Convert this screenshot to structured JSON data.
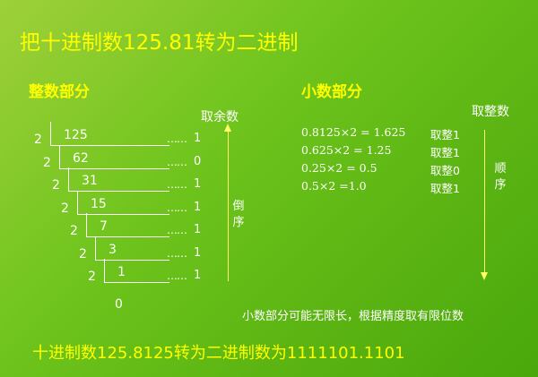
{
  "title": "把十进制数125.81转为二进制",
  "integer_part": {
    "heading": "整数部分",
    "remainder_label": "取余数",
    "reverse_label": "倒序",
    "steps": [
      {
        "divisor": "2",
        "value": "125",
        "dots": "……",
        "remainder": "1"
      },
      {
        "divisor": "2",
        "value": "62",
        "dots": "……",
        "remainder": "0"
      },
      {
        "divisor": "2",
        "value": "31",
        "dots": "……",
        "remainder": "1"
      },
      {
        "divisor": "2",
        "value": "15",
        "dots": "……",
        "remainder": "1"
      },
      {
        "divisor": "2",
        "value": "7",
        "dots": "……",
        "remainder": "1"
      },
      {
        "divisor": "2",
        "value": "3",
        "dots": "……",
        "remainder": "1"
      },
      {
        "divisor": "2",
        "value": "1",
        "dots": "……",
        "remainder": "1"
      }
    ],
    "final": "0"
  },
  "fraction_part": {
    "heading": "小数部分",
    "take_label": "取整数",
    "order_label": "顺序",
    "rows": [
      {
        "expr": "0.8125×2 = 1.625",
        "take": "取整1"
      },
      {
        "expr": "0.625×2 = 1.25",
        "take": "取整1"
      },
      {
        "expr": "0.25×2 = 0.5",
        "take": "取整0"
      },
      {
        "expr": "0.5×2 =1.0",
        "take": "取整1"
      }
    ],
    "note": "小数部分可能无限长，根据精度取有限位数"
  },
  "result": "十进制数125.8125转为二进制数为1111101.1101",
  "colors": {
    "accent": "#ffff00",
    "arrow": "#ffff66",
    "text": "#ffffff"
  }
}
